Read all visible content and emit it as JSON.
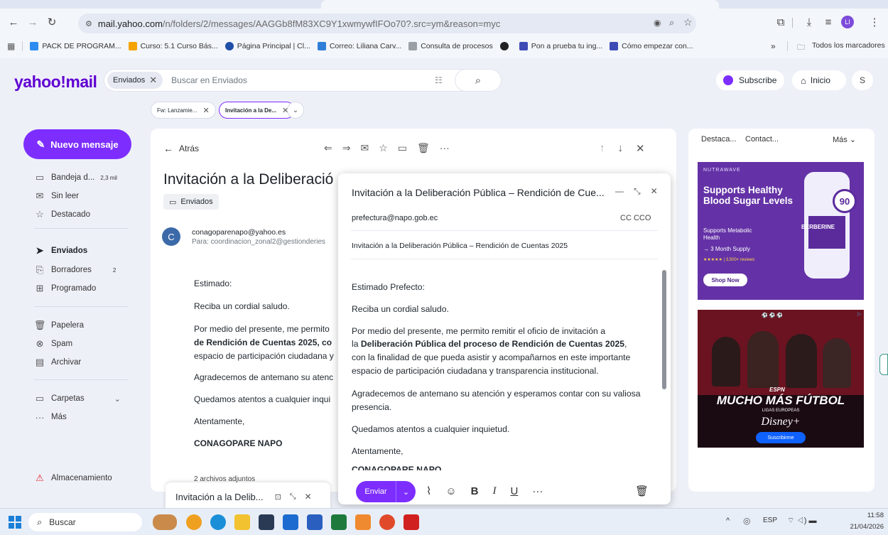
{
  "browser": {
    "url_host": "mail.yahoo.com",
    "url_rest": "/n/folders/2/messages/AAGGb8fM83XC9Y1xwmywfIFOo70?.src=ym&reason=myc",
    "bookmarks": [
      {
        "label": "PACK DE PROGRAM...",
        "color": "#2d8cf0"
      },
      {
        "label": "Curso: 5.1 Curso Bás...",
        "color": "#f4a300"
      },
      {
        "label": "Página Principal | Cl...",
        "color": "#1e4ea8"
      },
      {
        "label": "Correo: Liliana Carv...",
        "color": "#2f7fd8"
      },
      {
        "label": "Consulta de procesos",
        "color": "#9aa0a6"
      },
      {
        "label": "",
        "color": "#222222"
      },
      {
        "label": "Pon a prueba tu ing...",
        "color": "#3e4bb5"
      },
      {
        "label": "Cómo empezar con...",
        "color": "#3e4bb5"
      }
    ],
    "more_bookmarks": "»",
    "all_bookmarks": "Todos los marcadores",
    "profile_initial": "LI"
  },
  "yahoo": {
    "logo": "yahoo!mail",
    "search_chip": "Enviados",
    "search_placeholder": "Buscar en Enviados",
    "subscribe": "Subscribe",
    "home": "Inicio",
    "avatar": "S",
    "tabs": [
      {
        "label": "Fw: Lanzamie...",
        "active": false
      },
      {
        "label": "Invitación a la De...",
        "active": true
      }
    ]
  },
  "sidebar": {
    "new_message": "Nuevo mensaje",
    "items": [
      {
        "label": "Bandeja d...",
        "count": "2,3 mil",
        "icon": "inbox-icon"
      },
      {
        "label": "Sin leer",
        "count": "",
        "icon": "unread-icon"
      },
      {
        "label": "Destacado",
        "count": "",
        "icon": "star-icon"
      },
      {
        "label": "Enviados",
        "count": "",
        "icon": "send-icon"
      },
      {
        "label": "Borradores",
        "count": "2",
        "icon": "draft-icon"
      },
      {
        "label": "Programado",
        "count": "",
        "icon": "schedule-icon"
      },
      {
        "label": "Papelera",
        "count": "",
        "icon": "trash-icon"
      },
      {
        "label": "Spam",
        "count": "",
        "icon": "spam-icon"
      },
      {
        "label": "Archivar",
        "count": "",
        "icon": "archive-icon"
      },
      {
        "label": "Carpetas",
        "count": "",
        "icon": "folder-icon"
      },
      {
        "label": "Más",
        "count": "",
        "icon": "more-icon"
      }
    ],
    "storage": "Almacenamiento"
  },
  "message": {
    "back": "Atrás",
    "subject": "Invitación a la Deliberació",
    "folder_tag": "Enviados",
    "sender_initial": "C",
    "sender": "conagoparenapo@yahoo.es",
    "to": "Para: coordinacion_zonal2@gestionderies",
    "body": [
      "Estimado:",
      "Reciba un cordial saludo.",
      "Por medio del presente, me permito",
      "de Rendición de Cuentas 2025, co",
      "espacio de participación ciudadana y",
      "Agradecemos de antemano su atenc",
      "Quedamos atentos a cualquier inqui",
      "Atentamente,",
      "CONAGOPARE NAPO"
    ],
    "attachments": "2 archivos adjuntos"
  },
  "compose": {
    "title": "Invitación a la Deliberación Pública – Rendición de Cue...",
    "to": "prefectura@napo.gob.ec",
    "cc_bcc": "CC CCO",
    "subject": "Invitación a la Deliberación Pública – Rendición de Cuentas 2025",
    "greeting": "Estimado Prefecto:",
    "line2": "Reciba un cordial saludo.",
    "p1_a": "Por medio del presente, me permito remitir el oficio de invitación a",
    "p1_b_pre": "la ",
    "p1_b_bold": "Deliberación Pública del proceso de Rendición de Cuentas 2025",
    "p1_b_post": ",",
    "p1_c": "con la finalidad de que pueda asistir y acompañarnos en este importante",
    "p1_d": "espacio de participación ciudadana y transparencia institucional.",
    "p2_a": "Agradecemos de antemano su atención y esperamos contar con su valiosa",
    "p2_b": "presencia.",
    "p3": "Quedamos atentos a cualquier inquietud.",
    "p4": "Atentamente,",
    "p5": "CONAGOPARE NAPO",
    "send": "Enviar"
  },
  "minimized": {
    "title": "Invitación a la Delib..."
  },
  "rightcol": {
    "tabs": [
      "Destaca...",
      "Contact..."
    ],
    "more": "Más",
    "ad1": {
      "brand": "NUTRAWAVE",
      "headline": "Supports Healthy Blood Sugar Levels",
      "badge": "90",
      "product": "BERBERINE",
      "sub": "Supports Metabolic Health",
      "supply": "→ 3 Month Supply",
      "reviews": "★★★★★ | 3,500+ reviews",
      "cta": "Shop Now"
    },
    "ad2": {
      "network": "ESPN",
      "headline": "MUCHO MÁS FÚTBOL",
      "sub": "LIGAS EUROPEAS",
      "brand": "Disney+",
      "cta": "Suscribirme"
    }
  },
  "taskbar": {
    "search": "Buscar",
    "lang": "ESP",
    "time": "11:58",
    "date": "21/04/2026"
  }
}
